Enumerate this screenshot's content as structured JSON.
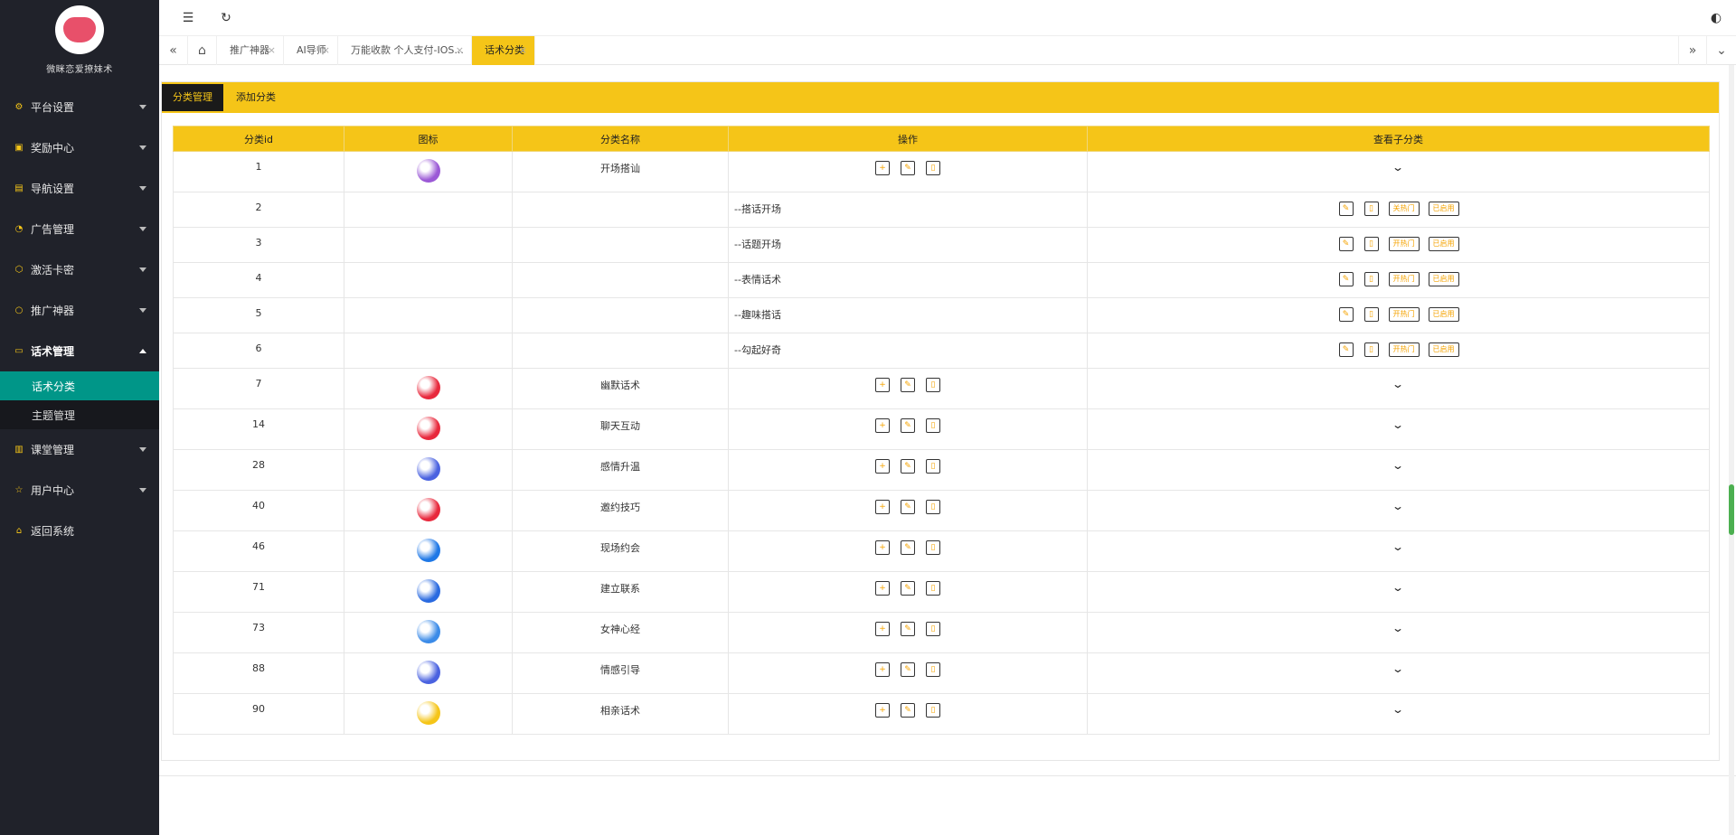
{
  "brand": {
    "title": "微眯恋爱撩妹术"
  },
  "sidebar": {
    "items": [
      {
        "label": "平台设置",
        "icon": "gear-icon",
        "glyph": "⚙"
      },
      {
        "label": "奖励中心",
        "icon": "video-icon",
        "glyph": "▣"
      },
      {
        "label": "导航设置",
        "icon": "layout-icon",
        "glyph": "▤"
      },
      {
        "label": "广告管理",
        "icon": "gauge-icon",
        "glyph": "◔"
      },
      {
        "label": "激活卡密",
        "icon": "cube-icon",
        "glyph": "⬡"
      },
      {
        "label": "推广神器",
        "icon": "circle-icon",
        "glyph": "○"
      },
      {
        "label": "话术管理",
        "icon": "doc-icon",
        "glyph": "▭"
      },
      {
        "label": "课堂管理",
        "icon": "book-icon",
        "glyph": "▥"
      },
      {
        "label": "用户中心",
        "icon": "star-icon",
        "glyph": "☆"
      },
      {
        "label": "返回系统",
        "icon": "home-icon",
        "glyph": "⌂"
      }
    ],
    "sub": [
      {
        "label": "话术分类"
      },
      {
        "label": "主题管理"
      }
    ]
  },
  "tabs": [
    {
      "label": "推广神器"
    },
    {
      "label": "AI导师"
    },
    {
      "label": "万能收款 个人支付-IOS..."
    },
    {
      "label": "话术分类"
    }
  ],
  "subtabs": [
    {
      "label": "分类管理"
    },
    {
      "label": "添加分类"
    }
  ],
  "table": {
    "headers": [
      "分类id",
      "图标",
      "分类名称",
      "操作",
      "查看子分类"
    ],
    "parent_btns": [
      "+",
      "✎",
      "▯"
    ],
    "child_btns": {
      "hot": "关热门",
      "hot_open": "开热门",
      "enabled": "已启用"
    },
    "rows": [
      {
        "id": "1",
        "name": "开场搭讪",
        "color": "#9b59d6",
        "type": "parent"
      },
      {
        "id": "2",
        "name": "--搭话开场",
        "type": "child",
        "hot": "关热门"
      },
      {
        "id": "3",
        "name": "--话题开场",
        "type": "child",
        "hot": "开热门"
      },
      {
        "id": "4",
        "name": "--表情话术",
        "type": "child",
        "hot": "开热门"
      },
      {
        "id": "5",
        "name": "--趣味搭话",
        "type": "child",
        "hot": "开热门"
      },
      {
        "id": "6",
        "name": "--勾起好奇",
        "type": "child",
        "hot": "开热门"
      },
      {
        "id": "7",
        "name": "幽默话术",
        "color": "#e8283c",
        "type": "parent"
      },
      {
        "id": "14",
        "name": "聊天互动",
        "color": "#e8283c",
        "type": "parent"
      },
      {
        "id": "28",
        "name": "感情升温",
        "color": "#4a62e0",
        "type": "parent"
      },
      {
        "id": "40",
        "name": "邀约技巧",
        "color": "#e8283c",
        "type": "parent"
      },
      {
        "id": "46",
        "name": "现场约会",
        "color": "#1f78e6",
        "type": "parent"
      },
      {
        "id": "71",
        "name": "建立联系",
        "color": "#2a6ae0",
        "type": "parent"
      },
      {
        "id": "73",
        "name": "女神心经",
        "color": "#3b8be8",
        "type": "parent"
      },
      {
        "id": "88",
        "name": "情感引导",
        "color": "#4a62e0",
        "type": "parent"
      },
      {
        "id": "90",
        "name": "相亲话术",
        "color": "#f5c518",
        "type": "parent"
      }
    ]
  },
  "colors": {
    "accent": "#f5c518",
    "sidebar": "#20222a",
    "active": "#009688"
  }
}
